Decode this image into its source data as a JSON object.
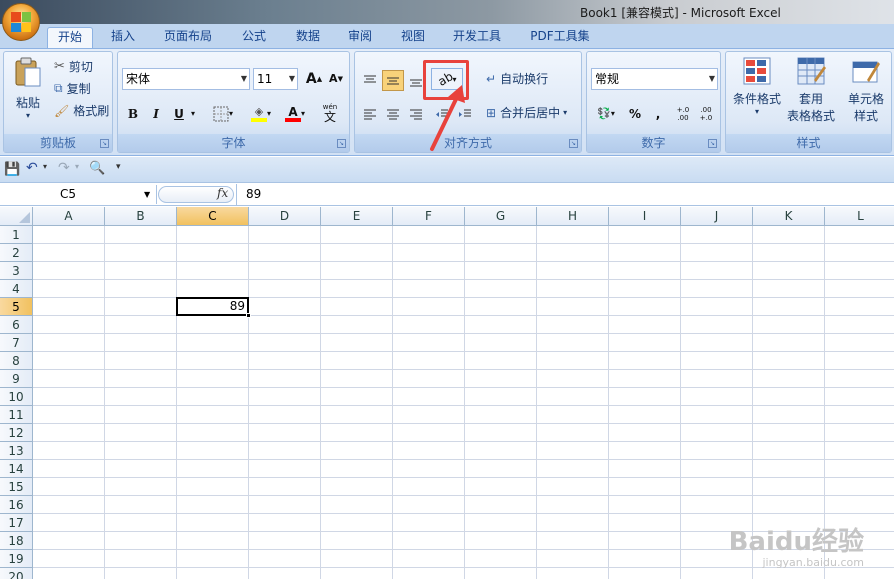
{
  "window": {
    "title": "Book1  [兼容模式] - Microsoft Excel"
  },
  "tabs": [
    "开始",
    "插入",
    "页面布局",
    "公式",
    "数据",
    "审阅",
    "视图",
    "开发工具",
    "PDF工具集"
  ],
  "clipboard": {
    "paste": "粘贴",
    "cut": "剪切",
    "copy": "复制",
    "format_painter": "格式刷",
    "label": "剪贴板"
  },
  "font": {
    "name": "宋体",
    "size": "11",
    "bold": "B",
    "italic": "I",
    "underline": "U",
    "grow": "A",
    "shrink": "A",
    "wen": "wén",
    "wen_char": "文",
    "label": "字体"
  },
  "alignment": {
    "wrap_text": "自动换行",
    "merge_center": "合并后居中",
    "label": "对齐方式"
  },
  "number": {
    "format": "常规",
    "percent": "%",
    "comma": ",",
    "inc_decimal": "+.0 .00",
    "dec_decimal": ".00 +.0",
    "label": "数字"
  },
  "styles": {
    "conditional": "条件格式",
    "table_line1": "套用",
    "table_line2": "表格格式",
    "cell_line1": "单元格",
    "cell_line2": "样式",
    "label": "样式"
  },
  "formula_bar": {
    "name_box": "C5",
    "fx": "fx",
    "value": "89"
  },
  "sheet": {
    "columns": [
      "A",
      "B",
      "C",
      "D",
      "E",
      "F",
      "G",
      "H",
      "I",
      "J",
      "K",
      "L"
    ],
    "rows": [
      "1",
      "2",
      "3",
      "4",
      "5",
      "6",
      "7",
      "8",
      "9",
      "10",
      "11",
      "12",
      "13",
      "14",
      "15",
      "16",
      "17",
      "18",
      "19",
      "20"
    ],
    "selected_cell": "C5",
    "selected_value": "89"
  },
  "watermark": {
    "brand": "Baidu经验",
    "url": "jingyan.baidu.com"
  },
  "colors": {
    "accent": "#e8423c",
    "selected_header": "#f1c15f"
  }
}
